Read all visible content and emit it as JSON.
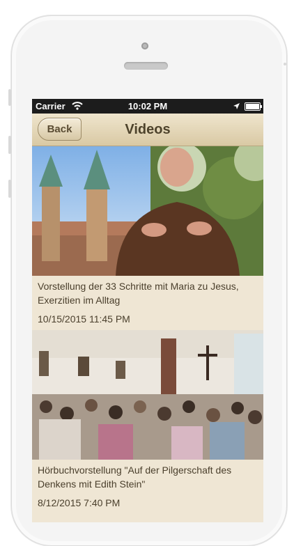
{
  "status_bar": {
    "carrier": "Carrier",
    "time": "10:02 PM"
  },
  "nav": {
    "back_label": "Back",
    "title": "Videos"
  },
  "videos": [
    {
      "title": "Vorstellung der 33 Schritte mit Maria zu Jesus, Exerzitien im Alltag",
      "date": "10/15/2015 11:45 PM"
    },
    {
      "title": "Hörbuchvorstellung \"Auf der Pilgerschaft des Denkens mit Edith Stein\"",
      "date": "8/12/2015 7:40 PM"
    }
  ],
  "colors": {
    "navbar": "#e3d6b8",
    "screen_background": "#efe6d4",
    "text": "#4a3f2c"
  }
}
